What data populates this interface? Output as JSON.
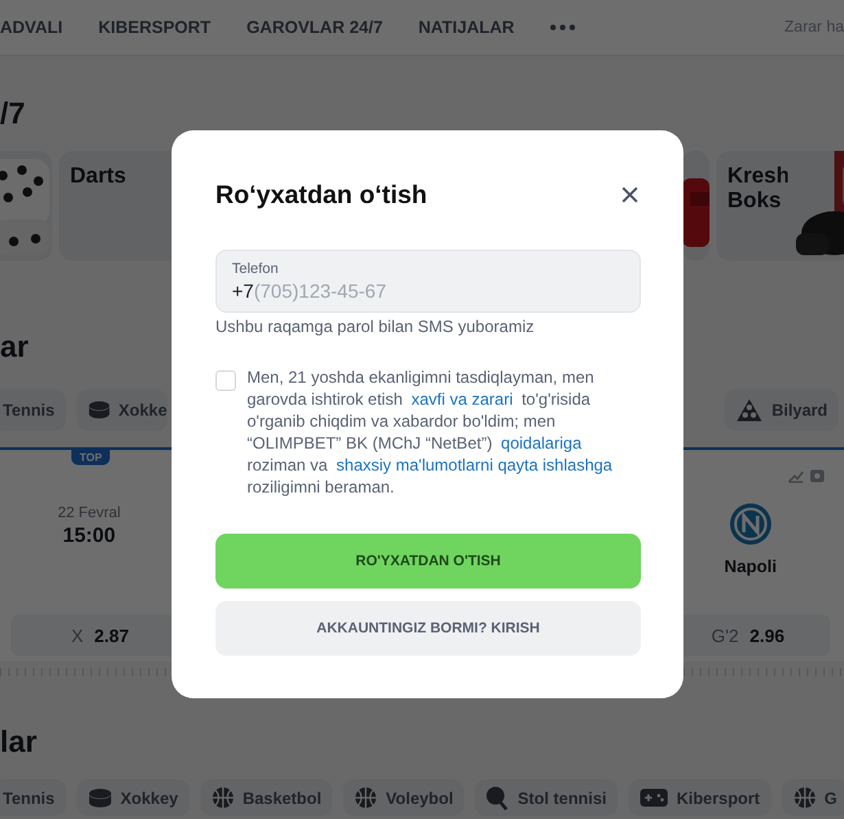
{
  "nav": {
    "items": [
      "ADVALI",
      "KIBERSPORT",
      "GAROVLAR 24/7",
      "NATIJALAR"
    ],
    "right": "Zarar ha"
  },
  "top_section": {
    "title": "/7",
    "cards": [
      {
        "kind": "picture"
      },
      {
        "kind": "titled",
        "title": "Darts"
      },
      {
        "kind": "picture"
      },
      {
        "kind": "titled",
        "title": "Kresh Boks"
      }
    ]
  },
  "live_section": {
    "title": "ar",
    "chips": [
      {
        "label": "Tennis"
      },
      {
        "label": "Xokke"
      },
      {
        "label": "Bilyard"
      }
    ],
    "match": {
      "badge": "TOP",
      "date": "22 Fevral",
      "time": "15:00",
      "team": "Napoli"
    },
    "odds": [
      {
        "label": "X",
        "value": "2.87"
      },
      {
        "label": "G'2",
        "value": "2.96"
      }
    ]
  },
  "bottom_section": {
    "title": "lar",
    "chips": [
      {
        "label": "Tennis"
      },
      {
        "label": "Xokkey"
      },
      {
        "label": "Basketbol"
      },
      {
        "label": "Voleybol"
      },
      {
        "label": "Stol tennisi"
      },
      {
        "label": "Kibersport"
      },
      {
        "label": "G"
      }
    ]
  },
  "modal": {
    "title": "Ro‘yxatdan o‘tish",
    "phone": {
      "label": "Telefon",
      "value": "+7",
      "placeholder": "(705)123-45-67"
    },
    "hint": "Ushbu raqamga parol bilan SMS yuboramiz",
    "consent": {
      "checked": false,
      "parts": [
        {
          "kind": "text",
          "text": "Men, 21 yoshda ekanligimni tasdiqlayman, men garovda ishtirok etish "
        },
        {
          "kind": "link",
          "text": "xavfi va zarari"
        },
        {
          "kind": "text",
          "text": " to'g'risida o'rganib chiqdim va xabardor bo'ldim; men “OLIMPBET” BK (MChJ “NetBet”) "
        },
        {
          "kind": "link",
          "text": "qoidalariga"
        },
        {
          "kind": "text",
          "text": " roziman va "
        },
        {
          "kind": "link",
          "text": "shaxsiy ma'lumotlarni qayta ishlashga"
        },
        {
          "kind": "text",
          "text": " roziligimni beraman."
        }
      ]
    },
    "buttons": [
      {
        "kind": "primary",
        "label": "RO'YXATDAN O'TISH"
      },
      {
        "kind": "secondary",
        "label": "AKKAUNTINGIZ BORMI? KIRISH"
      }
    ]
  }
}
